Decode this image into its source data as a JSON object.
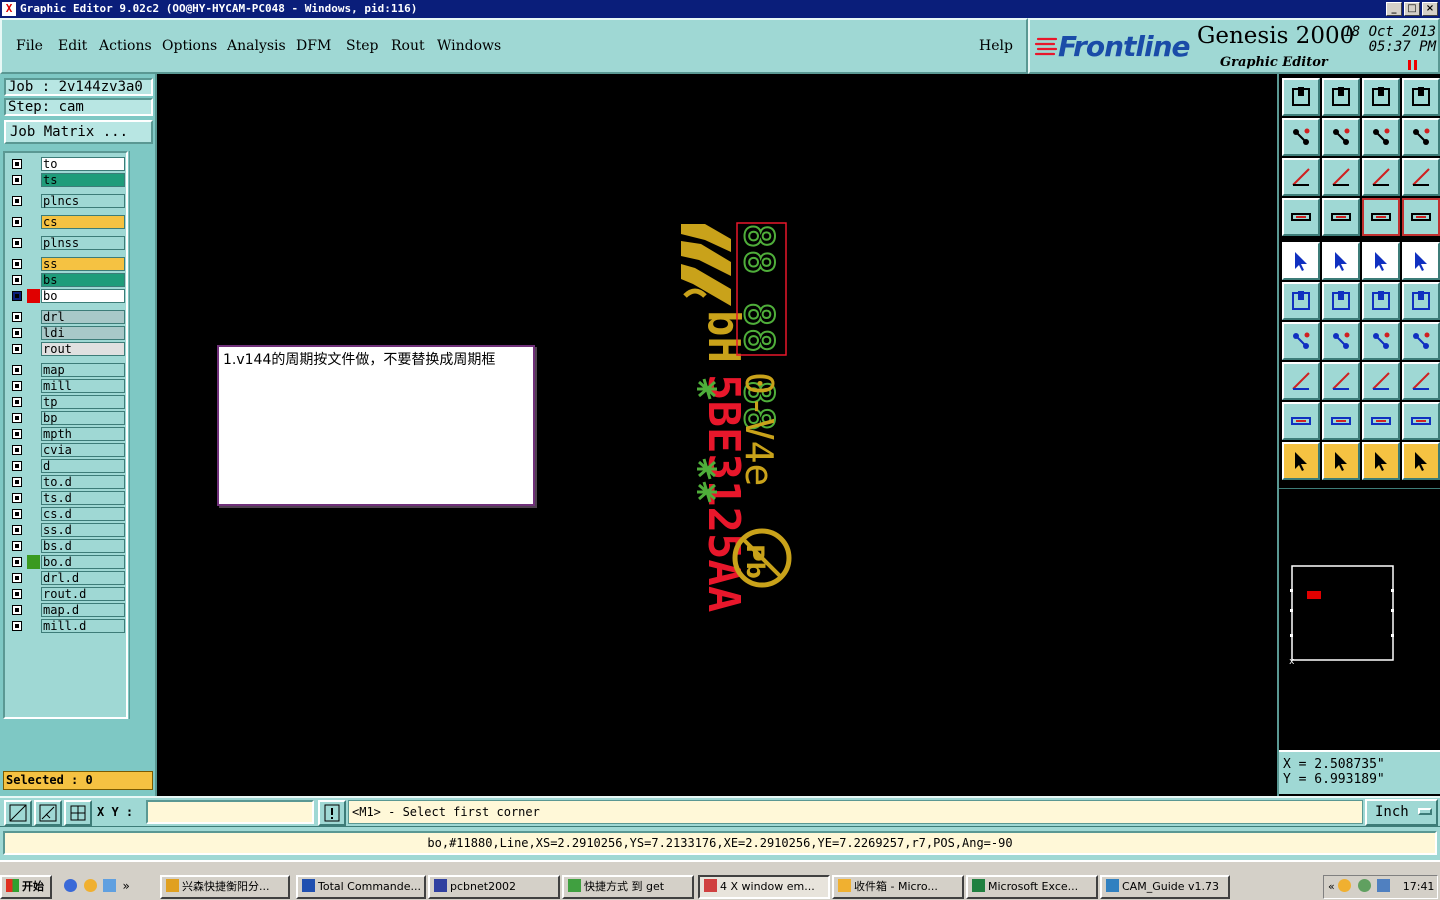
{
  "window": {
    "title": "Graphic Editor 9.02c2  (OO@HY-HYCAM-PC048 - Windows, pid:116)",
    "controls": [
      "_",
      "□",
      "×"
    ]
  },
  "menu": [
    "File",
    "Edit",
    "Actions",
    "Options",
    "Analysis",
    "DFM",
    "Step",
    "Rout",
    "Windows"
  ],
  "help_label": "Help",
  "brand": {
    "logo": "Frontline",
    "product": "Genesis 2000",
    "subtitle": "Graphic Editor",
    "date": "18 Oct 2013",
    "time": "05:37 PM"
  },
  "job": {
    "job_label": "Job : 2v144zv3a0",
    "step_label": "Step: cam",
    "matrix_button": "Job Matrix ..."
  },
  "layers": [
    {
      "name": "to",
      "color": "#ffffff",
      "mark": ""
    },
    {
      "name": "ts",
      "color": "#1f9c7a",
      "mark": ""
    },
    {
      "name": "plncs",
      "color": "#9fd8d4",
      "mark": ""
    },
    {
      "name": "cs",
      "color": "#f5c242",
      "mark": ""
    },
    {
      "name": "plnss",
      "color": "#9fd8d4",
      "mark": ""
    },
    {
      "name": "ss",
      "color": "#f5c242",
      "mark": ""
    },
    {
      "name": "bs",
      "color": "#1f9c7a",
      "mark": ""
    },
    {
      "name": "bo",
      "color": "#ffffff",
      "mark": "#e00000",
      "work": true
    },
    {
      "name": "drl",
      "color": "#a8c8c8",
      "mark": ""
    },
    {
      "name": "ldi",
      "color": "#a8c8c8",
      "mark": ""
    },
    {
      "name": "rout",
      "color": "#e0e0e0",
      "mark": ""
    },
    {
      "name": "map",
      "color": "#9fd8d4",
      "mark": ""
    },
    {
      "name": "mill",
      "color": "#9fd8d4",
      "mark": ""
    },
    {
      "name": "tp",
      "color": "#9fd8d4",
      "mark": ""
    },
    {
      "name": "bp",
      "color": "#9fd8d4",
      "mark": ""
    },
    {
      "name": "mpth",
      "color": "#9fd8d4",
      "mark": ""
    },
    {
      "name": "cvia",
      "color": "#9fd8d4",
      "mark": ""
    },
    {
      "name": "d",
      "color": "#9fd8d4",
      "mark": ""
    },
    {
      "name": "to.d",
      "color": "#9fd8d4",
      "mark": ""
    },
    {
      "name": "ts.d",
      "color": "#9fd8d4",
      "mark": ""
    },
    {
      "name": "cs.d",
      "color": "#9fd8d4",
      "mark": ""
    },
    {
      "name": "ss.d",
      "color": "#9fd8d4",
      "mark": ""
    },
    {
      "name": "bs.d",
      "color": "#9fd8d4",
      "mark": ""
    },
    {
      "name": "bo.d",
      "color": "#9fd8d4",
      "mark": "#3a9a20"
    },
    {
      "name": "drl.d",
      "color": "#9fd8d4",
      "mark": ""
    },
    {
      "name": "rout.d",
      "color": "#9fd8d4",
      "mark": ""
    },
    {
      "name": "map.d",
      "color": "#9fd8d4",
      "mark": ""
    },
    {
      "name": "mill.d",
      "color": "#9fd8d4",
      "mark": ""
    }
  ],
  "selected_label": "Selected : 0",
  "note_text": "1.v144的周期按文件做，不要替换成周期框",
  "canvas_text": {
    "yellow_code": "0-V4e",
    "red_code": "AA2512E3B5HHd",
    "digits": "88 88 88"
  },
  "coords": {
    "x": "X  = 2.508735\"",
    "y": "Y  = 6.993189\""
  },
  "cmd": {
    "xy_label": "X Y :",
    "xy_value": "",
    "prompt": "<M1> - Select first corner",
    "unit": "Inch"
  },
  "status_line": "bo,#11880,Line,XS=2.2910256,YS=7.2133176,XE=2.2910256,YE=7.2269257,r7,POS,Ang=-90",
  "taskbar": {
    "start": "开始",
    "items": [
      "兴森快捷衡阳分...",
      "Total Commande...",
      "pcbnet2002",
      "快捷方式 到 get",
      "4 X window em...",
      "收件箱 - Micro...",
      "Microsoft Exce...",
      "CAM_Guide v1.73"
    ],
    "clock": "17:41"
  },
  "colors": {
    "panel": "#9fd8d4",
    "panel_dark": "#7ec8c4",
    "canvas": "#000000",
    "yellow": "#c9a21a",
    "red": "#e8172b",
    "green": "#4fae3a"
  }
}
